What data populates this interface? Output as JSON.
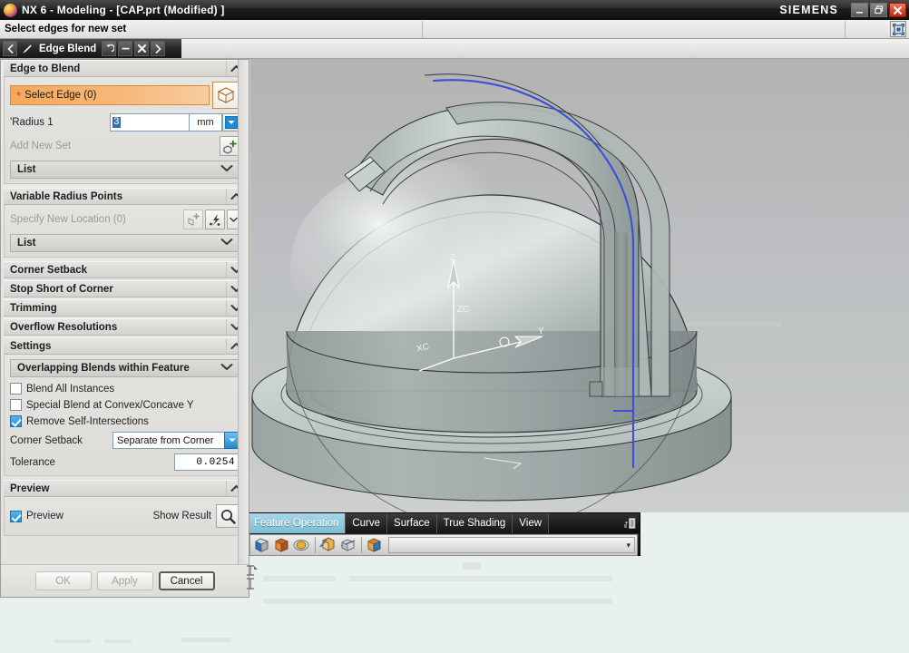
{
  "window": {
    "title": "NX 6 - Modeling - [CAP.prt (Modified) ]",
    "brand": "SIEMENS",
    "logo_icon": "nx-logo-icon",
    "minimize_label": "–",
    "restore_label": "❐",
    "close_label": "✕"
  },
  "cue_bar": {
    "message": "Select edges for new set",
    "field2": "",
    "field3": "",
    "indicator_icon": "selection-indicator-icon"
  },
  "selection_toolbar": {
    "back_icon": "◀",
    "arrow_icon": "cursor-arrow-icon",
    "command_label": "Edge Blend",
    "undo_icon": "↺",
    "deselect_icon": "–",
    "cancel_icon": "✕",
    "forward_icon": "▶"
  },
  "dialog": {
    "groups": {
      "edge_to_blend": {
        "title": "Edge to Blend",
        "expanded": true,
        "select_edge_label": "Select Edge (0)",
        "select_edge_required": "*",
        "cube_icon": "solid-body-icon",
        "radius_label": "'Radius 1",
        "radius_value": "3",
        "radius_unit": "mm",
        "radius_spin_icon": "▼",
        "add_new_set_label": "Add New Set",
        "add_new_set_icon": "add-set-icon",
        "list_label": "List",
        "list_chevron": "∨"
      },
      "variable_radius_points": {
        "title": "Variable Radius Points",
        "expanded": true,
        "specify_location_label": "Specify New Location (0)",
        "point_icon": "point-constructor-icon",
        "snap_icon": "snap-point-icon",
        "dropdown_icon": "∨",
        "list_label": "List",
        "list_chevron": "∨"
      },
      "corner_setback": {
        "title": "Corner Setback",
        "expanded": false,
        "chevron": "∨"
      },
      "stop_short_of_corner": {
        "title": "Stop Short of Corner",
        "expanded": false,
        "chevron": "∨"
      },
      "trimming": {
        "title": "Trimming",
        "expanded": false,
        "chevron": "∨"
      },
      "overflow_resolutions": {
        "title": "Overflow Resolutions",
        "expanded": false,
        "chevron": "∨"
      },
      "settings": {
        "title": "Settings",
        "expanded": true,
        "chevron": "∧",
        "overlapping_label": "Overlapping Blends within Feature",
        "overlapping_chevron": "∨",
        "checkboxes": [
          {
            "label": "Blend All Instances",
            "checked": false
          },
          {
            "label": "Special Blend at Convex/Concave Y",
            "checked": false
          },
          {
            "label": "Remove Self-Intersections",
            "checked": true
          }
        ],
        "corner_setback_label": "Corner Setback",
        "corner_setback_value": "Separate from Corner",
        "corner_setback_arrow": "▼",
        "tolerance_label": "Tolerance",
        "tolerance_value": "0.0254"
      },
      "preview": {
        "title": "Preview",
        "expanded": true,
        "chevron": "∧",
        "preview_label": "Preview",
        "preview_checked": true,
        "show_result_label": "Show Result",
        "show_result_icon": "magnifier-icon"
      }
    },
    "footer": {
      "ok_label": "OK",
      "apply_label": "Apply",
      "cancel_label": "Cancel"
    }
  },
  "viewport": {
    "triad": {
      "z_label": "Z",
      "zc_label": "ZC",
      "y_label": "Y",
      "xc_label": "XC"
    },
    "highlight_color": "#3b4fd8",
    "body_color": "#b4bcbb",
    "background_top": "#b3b3b3",
    "background_bottom": "#cdd0ce"
  },
  "bottom_toolbar": {
    "tabs": [
      {
        "label": "Feature Operation",
        "active": true
      },
      {
        "label": "Curve",
        "active": false
      },
      {
        "label": "Surface",
        "active": false
      },
      {
        "label": "True Shading",
        "active": false
      },
      {
        "label": "View",
        "active": false
      }
    ],
    "menu_icon": "toolbar-options-icon",
    "icons": [
      "unite-icon",
      "subtract-icon",
      "intersect-icon",
      "trim-body-icon",
      "split-body-icon",
      "edge-blend-icon"
    ],
    "combo_arrow": "▾"
  }
}
